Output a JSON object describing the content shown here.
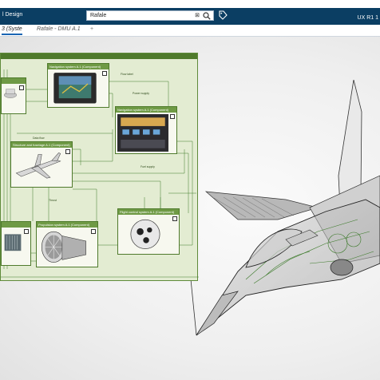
{
  "header": {
    "app_title": "l Design",
    "search_value": "Rafale",
    "user_label": "UX R1 1"
  },
  "tabs": [
    {
      "label": "3 (Syste"
    },
    {
      "label": "Rafale - DMU A.1"
    },
    {
      "label": "+"
    }
  ],
  "diagram": {
    "components": [
      {
        "label": "Navigation system A.1 (Component)"
      },
      {
        "label": "Navigation system A.1 (Component)"
      },
      {
        "label": "Structure and fuselage A.1 (Component)"
      },
      {
        "label": "Propulsion system A.1 (Component)"
      },
      {
        "label": "Flight control system A.1 (Component)"
      }
    ],
    "flows": [
      "Flow label",
      "Power supply",
      "Data flow",
      "Fuel supply",
      "Thrust"
    ]
  },
  "colors": {
    "top_bar": "#0b3e63",
    "diagram_fill": "#e3ecd2",
    "diagram_border": "#4f7a2c",
    "tab_accent": "#1a66b4"
  }
}
